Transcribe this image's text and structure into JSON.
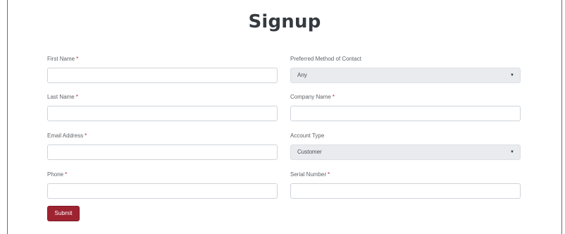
{
  "form": {
    "title": "Signup",
    "required_marker": "*",
    "fields": {
      "first_name": {
        "label": "First Name",
        "value": ""
      },
      "last_name": {
        "label": "Last Name",
        "value": ""
      },
      "email": {
        "label": "Email Address",
        "value": ""
      },
      "phone": {
        "label": "Phone",
        "value": ""
      },
      "preferred_contact": {
        "label": "Preferred Method of Contact",
        "selected": "Any"
      },
      "company_name": {
        "label": "Company Name",
        "value": ""
      },
      "account_type": {
        "label": "Account Type",
        "selected": "Customer"
      },
      "serial_number": {
        "label": "Serial Number",
        "value": ""
      }
    },
    "submit_label": "Submit"
  },
  "colors": {
    "title": "#343a40",
    "required": "#b02a37",
    "submit_bg": "#9e2331",
    "select_bg": "#e9ebef"
  },
  "icons": {
    "select_caret": "caret-down-icon"
  }
}
